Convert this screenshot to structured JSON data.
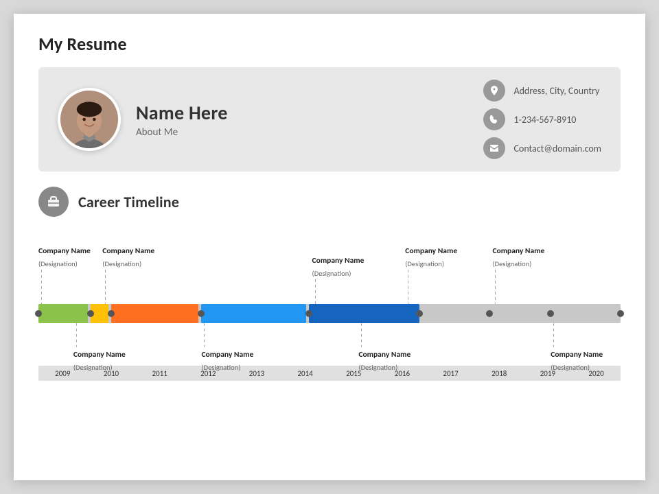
{
  "slide": {
    "title": "My Resume",
    "header": {
      "profile": {
        "name": "Name Here",
        "subtitle": "About Me"
      },
      "contact": {
        "address": "Address, City, Country",
        "phone": "1-234-567-8910",
        "email": "Contact@domain.com"
      }
    },
    "career": {
      "section_title": "Career Timeline",
      "top_items": [
        {
          "id": 1,
          "company": "Company Name",
          "designation": "(Designation)",
          "left_pct": 0.5,
          "line_height": 60,
          "row": "top"
        },
        {
          "id": 2,
          "company": "Company Name",
          "designation": "(Designation)",
          "left_pct": 11.5,
          "line_height": 60,
          "row": "top"
        },
        {
          "id": 3,
          "company": "Company Name",
          "designation": "(Designation)",
          "left_pct": 47.5,
          "line_height": 45,
          "row": "top"
        },
        {
          "id": 4,
          "company": "Company Name",
          "designation": "(Designation)",
          "left_pct": 62.5,
          "line_height": 60,
          "row": "top"
        },
        {
          "id": 5,
          "company": "Company Name",
          "designation": "(Designation)",
          "left_pct": 78,
          "line_height": 60,
          "row": "top"
        }
      ],
      "bottom_items": [
        {
          "id": 6,
          "company": "Company Name",
          "designation": "(Designation)",
          "left_pct": 6.5,
          "line_height": 45,
          "row": "bottom"
        },
        {
          "id": 7,
          "company": "Company Name",
          "designation": "(Designation)",
          "left_pct": 28.5,
          "line_height": 45,
          "row": "bottom"
        },
        {
          "id": 8,
          "company": "Company Name",
          "designation": "(Designation)",
          "left_pct": 55,
          "line_height": 45,
          "row": "bottom"
        },
        {
          "id": 9,
          "company": "Company Name",
          "designation": "(Designation)",
          "left_pct": 89,
          "line_height": 45,
          "row": "bottom"
        }
      ],
      "bars": [
        {
          "id": 1,
          "left_pct": 0,
          "width_pct": 8.5,
          "color": "#8bc34a"
        },
        {
          "id": 2,
          "left_pct": 9,
          "width_pct": 3,
          "color": "#ffc107"
        },
        {
          "id": 3,
          "left_pct": 12.5,
          "width_pct": 15,
          "color": "#ff6f20"
        },
        {
          "id": 4,
          "left_pct": 28,
          "width_pct": 18,
          "color": "#2196f3"
        },
        {
          "id": 5,
          "left_pct": 46.5,
          "width_pct": 19,
          "color": "#1565c0"
        },
        {
          "id": 6,
          "left_pct": 65.5,
          "width_pct": 34.5,
          "color": "#9e9e9e"
        }
      ],
      "dots": [
        {
          "left_pct": 0
        },
        {
          "left_pct": 9
        },
        {
          "left_pct": 12.5
        },
        {
          "left_pct": 28
        },
        {
          "left_pct": 46.5
        },
        {
          "left_pct": 65.5
        },
        {
          "left_pct": 77.5
        },
        {
          "left_pct": 88
        },
        {
          "left_pct": 100
        }
      ],
      "years": [
        "2009",
        "2010",
        "2011",
        "2012",
        "2013",
        "2014",
        "2015",
        "2016",
        "2017",
        "2018",
        "2019",
        "2020"
      ]
    }
  }
}
